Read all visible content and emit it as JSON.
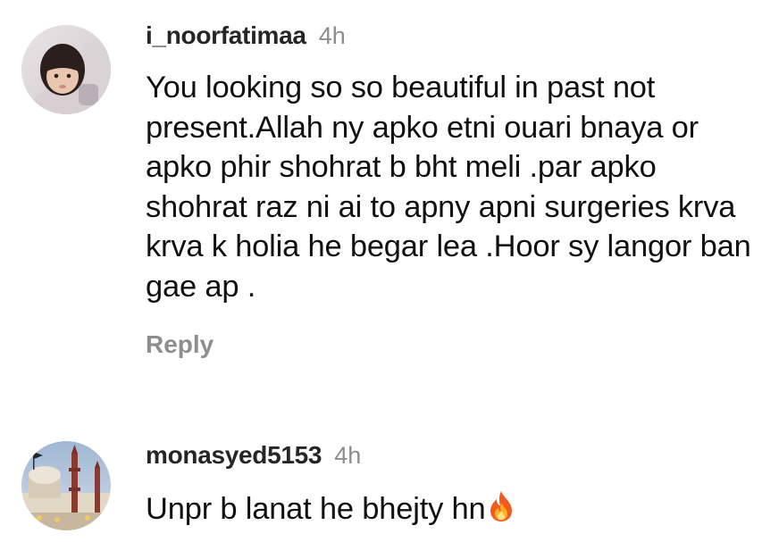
{
  "comments": [
    {
      "username": "i_noorfatimaa",
      "time": "4h",
      "text": "You looking so so beautiful in past not present.Allah ny apko etni ouari bnaya or apko phir shohrat b bht meli .par apko shohrat raz ni ai to apny apni surgeries krva krva k holia he begar lea .Hoor sy langor ban gae ap .",
      "reply_label": "Reply",
      "avatar": "child-profile-photo"
    },
    {
      "username": "monasyed5153",
      "time": "4h",
      "text": "Unpr b lanat he bhejty hn",
      "emoji": "fire-icon",
      "avatar": "mosque-profile-photo"
    }
  ]
}
